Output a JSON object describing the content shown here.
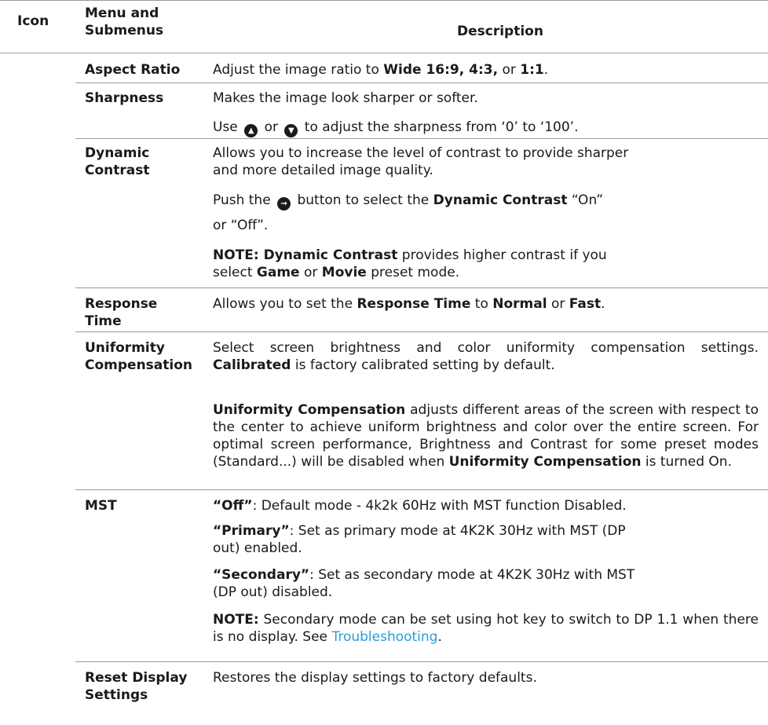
{
  "header": {
    "icon": "Icon",
    "menu_1": "Menu and",
    "menu_2": "Submenus",
    "description": "Description"
  },
  "rows": {
    "aspect": {
      "menu": "Aspect Ratio",
      "t1": "Adjust the image ratio to ",
      "b1": "Wide 16:9, 4:3,",
      "t2": " or ",
      "b2": "1:1",
      "t3": "."
    },
    "sharpness": {
      "menu": "Sharpness",
      "line1": "Makes the image look sharper or softer.",
      "l2a": "Use ",
      "l2b": " or ",
      "l2c": " to adjust the sharpness from ‘0’ to ‘100’.",
      "icon_up": "chevron-up",
      "icon_down": "chevron-down"
    },
    "dynamic": {
      "menu_1": "Dynamic",
      "menu_2": "Contrast",
      "p1": "Allows you to increase the level of contrast to provide sharper and more detailed image quality.",
      "p2a": "Push the ",
      "p2b": " button to select the ",
      "p2c": "Dynamic Contrast",
      "p2d": " “On”",
      "p3": "or “Off”.",
      "n1": "NOTE: Dynamic Contrast",
      "n2": " provides higher contrast if you select ",
      "n3": "Game",
      "n4": " or ",
      "n5": "Movie",
      "n6": " preset mode.",
      "icon_right": "arrow-right"
    },
    "response": {
      "menu_1": "Response",
      "menu_2": "Time",
      "a": "Allows you to set the ",
      "b": "Response Time",
      "c": " to ",
      "d": "Normal",
      "e": " or ",
      "f": "Fast",
      "g": "."
    },
    "uniformity": {
      "menu_1": "Uniformity",
      "menu_2": "Compensation",
      "p1a": "Select screen brightness and color uniformity compensation settings. ",
      "p1b": "Calibrated",
      "p1c": " is factory calibrated setting by default.",
      "p2a": "Uniformity Compensation",
      "p2b": " adjusts different areas of the screen with respect to the center to achieve uniform brightness and color over the entire screen. For optimal screen performance, Brightness and Contrast for some preset modes (Standard...) will be disabled when ",
      "p2c": "Uniformity Compensation",
      "p2d": " is turned On."
    },
    "mst": {
      "menu": "MST",
      "off_b": "“Off”",
      "off_t": ": Default mode -  4k2k 60Hz with MST function Disabled.",
      "pri_b": "“Primary”",
      "pri_t": ": Set as primary mode at 4K2K 30Hz  with MST (DP out) enabled.",
      "sec_b": "“Secondary”",
      "sec_t": ": Set as secondary mode at 4K2K 30Hz  with MST (DP out) disabled.",
      "note_b": "NOTE:",
      "note_t": "  Secondary mode can be set using hot key to switch to DP 1.1 when there is no display.  See ",
      "link": "Troubleshooting",
      "end": "."
    },
    "reset": {
      "menu_1": "Reset Display",
      "menu_2": "Settings",
      "desc": "Restores the display settings to factory defaults."
    }
  },
  "colors": {
    "link": "#2b9bd6",
    "rule": "#9a9a9a",
    "text": "#1a1a1a"
  }
}
